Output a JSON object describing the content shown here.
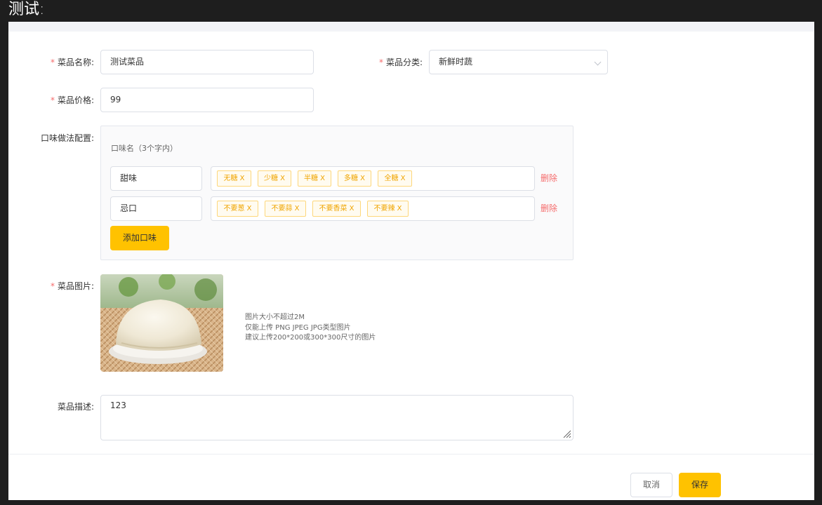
{
  "page": {
    "title": "测试:"
  },
  "form": {
    "name": {
      "label": "菜品名称:",
      "value": "测试菜品"
    },
    "category": {
      "label": "菜品分类:",
      "value": "新鲜时蔬"
    },
    "price": {
      "label": "菜品价格:",
      "value": "99"
    },
    "flavor": {
      "label": "口味做法配置:",
      "header": "口味名（3个字内）",
      "rows": [
        {
          "name": "甜味",
          "tags": [
            "无糖 X",
            "少糖 X",
            "半糖 X",
            "多糖 X",
            "全糖 X"
          ],
          "delete_label": "删除"
        },
        {
          "name": "忌口",
          "tags": [
            "不要葱 X",
            "不要蒜 X",
            "不要香菜 X",
            "不要辣 X"
          ],
          "delete_label": "删除"
        }
      ],
      "add_label": "添加口味"
    },
    "image": {
      "label": "菜品图片:",
      "tips": [
        "图片大小不超过2M",
        "仅能上传 PNG JPEG JPG类型图片",
        "建议上传200*200或300*300尺寸的图片"
      ]
    },
    "description": {
      "label": "菜品描述:",
      "value": "123"
    }
  },
  "footer": {
    "cancel_label": "取消",
    "save_label": "保存"
  },
  "colors": {
    "accent": "#ffc200",
    "required": "#f56c6c",
    "tag_text": "#f0a500"
  }
}
